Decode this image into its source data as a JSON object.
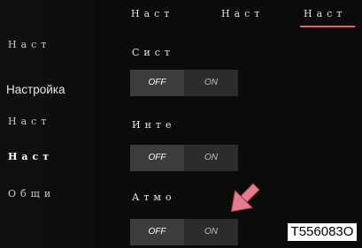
{
  "tabs": [
    "Наст",
    "Наст",
    "Наст"
  ],
  "sidebar": {
    "items": [
      "Наст",
      "Настройка",
      "Наст",
      "Наст",
      "Общи"
    ]
  },
  "settings": [
    {
      "label": "Сист",
      "off": "OFF",
      "on": "ON",
      "selected": "OFF"
    },
    {
      "label": "",
      "off": "OFF",
      "on": "ON",
      "selected": "OFF"
    },
    {
      "label": "Инте",
      "off": "OFF",
      "on": "ON",
      "selected": "OFF"
    },
    {
      "label": "Атмо",
      "off": "OFF",
      "on": "ON",
      "selected": "OFF"
    }
  ],
  "annotation": {
    "code": "T556083O",
    "arrow_color": "#e87a8f"
  },
  "colors": {
    "accent": "#e0606f",
    "background": "#0b0b0b"
  }
}
